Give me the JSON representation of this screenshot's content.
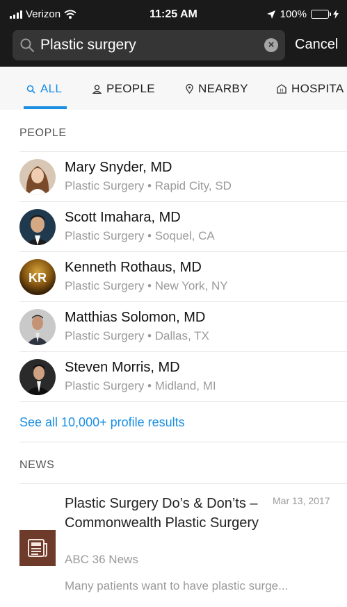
{
  "status_bar": {
    "carrier": "Verizon",
    "time": "11:25 AM",
    "battery": "100%",
    "battery_level": 1.0
  },
  "search": {
    "query": "Plastic surgery",
    "cancel_label": "Cancel"
  },
  "tabs": [
    {
      "label": "ALL",
      "icon": "search-icon",
      "active": true
    },
    {
      "label": "PEOPLE",
      "icon": "person-icon",
      "active": false
    },
    {
      "label": "NEARBY",
      "icon": "location-pin-icon",
      "active": false
    },
    {
      "label": "HOSPITA",
      "icon": "hospital-icon",
      "active": false
    }
  ],
  "people_section": {
    "heading": "PEOPLE",
    "items": [
      {
        "name": "Mary Snyder, MD",
        "subtitle": "Plastic Surgery • Rapid City, SD"
      },
      {
        "name": "Scott Imahara, MD",
        "subtitle": "Plastic Surgery • Soquel, CA"
      },
      {
        "name": "Kenneth Rothaus, MD",
        "subtitle": "Plastic Surgery • New York, NY",
        "initials": "KR"
      },
      {
        "name": "Matthias Solomon, MD",
        "subtitle": "Plastic Surgery • Dallas, TX"
      },
      {
        "name": "Steven Morris, MD",
        "subtitle": "Plastic Surgery • Midland, MI"
      }
    ],
    "see_all": "See all 10,000+ profile results"
  },
  "news_section": {
    "heading": "NEWS",
    "items": [
      {
        "title": "Plastic Surgery Do’s & Don’ts – Commonwealth Plastic Surgery",
        "date": "Mar 13, 2017",
        "source": "ABC 36 News",
        "snippet": "Many patients want to have plastic surge..."
      }
    ]
  },
  "colors": {
    "accent": "#1a8fe3",
    "header_bg": "#1a1a1a",
    "battery": "#4cd964"
  }
}
